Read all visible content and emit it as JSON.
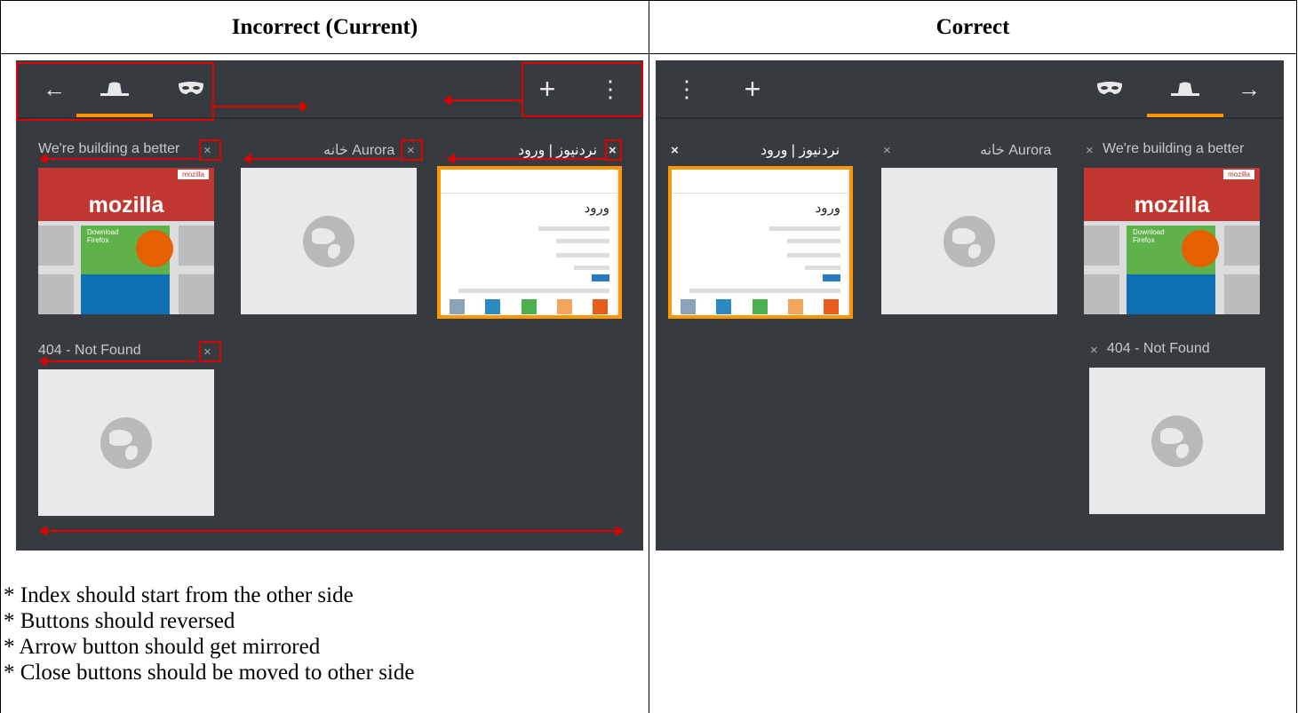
{
  "headers": {
    "incorrect": "Incorrect (Current)",
    "correct": "Correct"
  },
  "tabs": {
    "mozilla": "We're building a better",
    "aurora": "خانه Aurora",
    "login": "نردنیوز | ورود",
    "notfound": "404 - Not Found"
  },
  "thumb_text": {
    "mozilla_tag": "mozilla",
    "mozilla_word": "mozilla",
    "download": "Download",
    "firefox": "Firefox",
    "login_heading": "ورود"
  },
  "icons": {
    "close": "×",
    "back": "←",
    "forward": "→",
    "add": "+",
    "menu": "⋮"
  },
  "colors": {
    "accent": "#ff9500",
    "annotation": "#e00000",
    "toolbar": "#373a3f"
  },
  "notes": [
    "* Index should start from the other side",
    "* Buttons should reversed",
    "* Arrow button should get mirrored",
    "* Close buttons should be moved to other side"
  ]
}
